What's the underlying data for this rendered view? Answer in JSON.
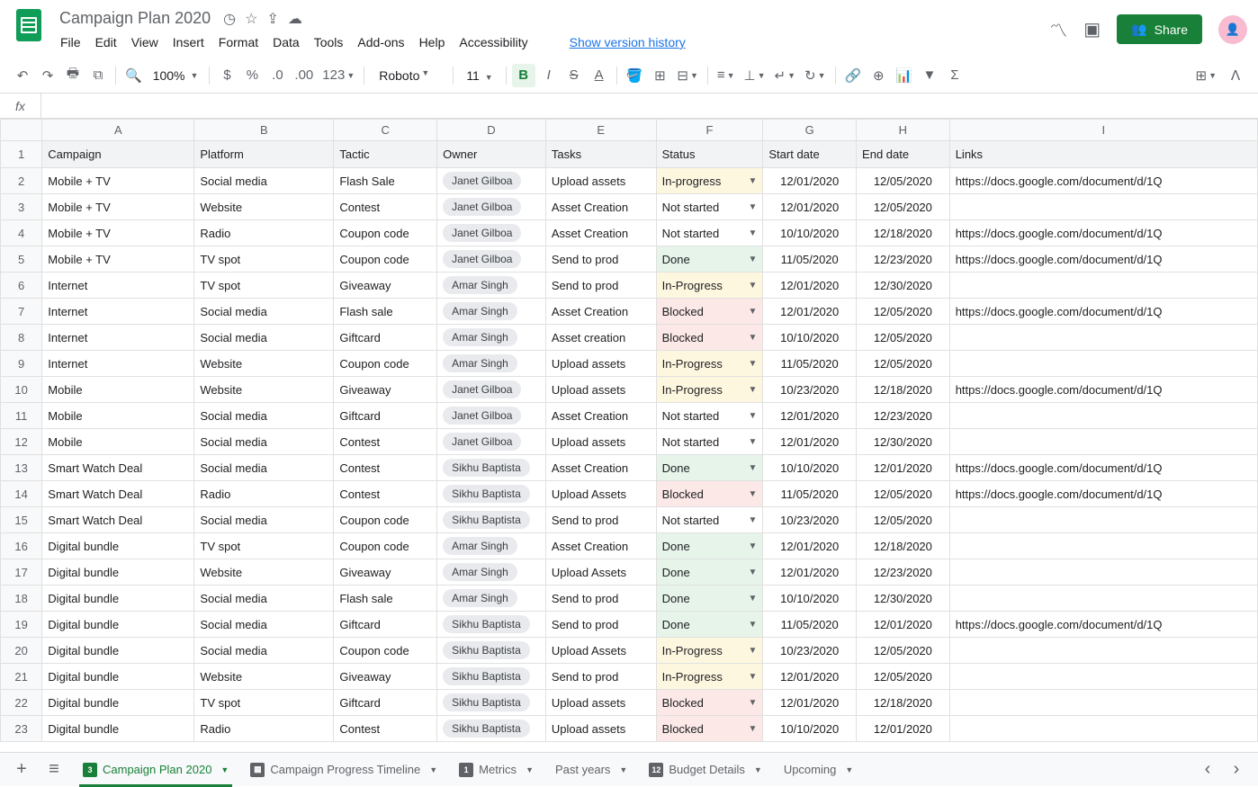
{
  "doc": {
    "title": "Campaign Plan 2020",
    "version_link": "Show version history"
  },
  "menu": [
    "File",
    "Edit",
    "View",
    "Insert",
    "Format",
    "Data",
    "Tools",
    "Add-ons",
    "Help",
    "Accessibility"
  ],
  "share_label": "Share",
  "toolbar": {
    "zoom": "100%",
    "font": "Roboto",
    "font_size": "11",
    "more_formats": "123"
  },
  "fx_label": "fx",
  "columns": [
    "A",
    "B",
    "C",
    "D",
    "E",
    "F",
    "G",
    "H",
    "I"
  ],
  "headers": {
    "A": "Campaign",
    "B": "Platform",
    "C": "Tactic",
    "D": "Owner",
    "E": "Tasks",
    "F": "Status",
    "G": "Start date",
    "H": "End date",
    "I": "Links"
  },
  "rows": [
    {
      "n": 2,
      "campaign": "Mobile + TV",
      "platform": "Social media",
      "tactic": "Flash Sale",
      "owner": "Janet Gilboa",
      "tasks": "Upload assets",
      "status": "In-progress",
      "status_cls": "st-inprogress",
      "start": "12/01/2020",
      "end": "12/05/2020",
      "links": "https://docs.google.com/document/d/1Q"
    },
    {
      "n": 3,
      "campaign": "Mobile + TV",
      "platform": "Website",
      "tactic": "Contest",
      "owner": "Janet Gilboa",
      "tasks": "Asset Creation",
      "status": "Not started",
      "status_cls": "st-notstarted",
      "start": "12/01/2020",
      "end": "12/05/2020",
      "links": ""
    },
    {
      "n": 4,
      "campaign": "Mobile + TV",
      "platform": "Radio",
      "tactic": "Coupon code",
      "owner": "Janet Gilboa",
      "tasks": "Asset Creation",
      "status": "Not started",
      "status_cls": "st-notstarted",
      "start": "10/10/2020",
      "end": "12/18/2020",
      "links": "https://docs.google.com/document/d/1Q"
    },
    {
      "n": 5,
      "campaign": "Mobile + TV",
      "platform": "TV spot",
      "tactic": "Coupon code",
      "owner": "Janet Gilboa",
      "tasks": "Send to prod",
      "status": "Done",
      "status_cls": "st-done",
      "start": "11/05/2020",
      "end": "12/23/2020",
      "links": "https://docs.google.com/document/d/1Q"
    },
    {
      "n": 6,
      "campaign": "Internet",
      "platform": "TV spot",
      "tactic": "Giveaway",
      "owner": "Amar Singh",
      "tasks": "Send to prod",
      "status": "In-Progress",
      "status_cls": "st-inprogress",
      "start": "12/01/2020",
      "end": "12/30/2020",
      "links": ""
    },
    {
      "n": 7,
      "campaign": "Internet",
      "platform": "Social media",
      "tactic": "Flash sale",
      "owner": "Amar Singh",
      "tasks": "Asset Creation",
      "status": "Blocked",
      "status_cls": "st-blocked",
      "start": "12/01/2020",
      "end": "12/05/2020",
      "links": "https://docs.google.com/document/d/1Q"
    },
    {
      "n": 8,
      "campaign": "Internet",
      "platform": "Social media",
      "tactic": "Giftcard",
      "owner": "Amar Singh",
      "tasks": "Asset creation",
      "status": "Blocked",
      "status_cls": "st-blocked",
      "start": "10/10/2020",
      "end": "12/05/2020",
      "links": ""
    },
    {
      "n": 9,
      "campaign": "Internet",
      "platform": "Website",
      "tactic": "Coupon code",
      "owner": "Amar Singh",
      "tasks": "Upload assets",
      "status": "In-Progress",
      "status_cls": "st-inprogress",
      "start": "11/05/2020",
      "end": "12/05/2020",
      "links": ""
    },
    {
      "n": 10,
      "campaign": "Mobile",
      "platform": "Website",
      "tactic": "Giveaway",
      "owner": "Janet Gilboa",
      "tasks": "Upload assets",
      "status": "In-Progress",
      "status_cls": "st-inprogress",
      "start": "10/23/2020",
      "end": "12/18/2020",
      "links": "https://docs.google.com/document/d/1Q"
    },
    {
      "n": 11,
      "campaign": "Mobile",
      "platform": "Social media",
      "tactic": "Giftcard",
      "owner": "Janet Gilboa",
      "tasks": "Asset Creation",
      "status": "Not started",
      "status_cls": "st-notstarted",
      "start": "12/01/2020",
      "end": "12/23/2020",
      "links": ""
    },
    {
      "n": 12,
      "campaign": "Mobile",
      "platform": "Social media",
      "tactic": "Contest",
      "owner": "Janet Gilboa",
      "tasks": "Upload assets",
      "status": "Not started",
      "status_cls": "st-notstarted",
      "start": "12/01/2020",
      "end": "12/30/2020",
      "links": ""
    },
    {
      "n": 13,
      "campaign": "Smart Watch Deal",
      "platform": "Social media",
      "tactic": "Contest",
      "owner": "Sikhu Baptista",
      "tasks": "Asset Creation",
      "status": "Done",
      "status_cls": "st-done",
      "start": "10/10/2020",
      "end": "12/01/2020",
      "links": "https://docs.google.com/document/d/1Q"
    },
    {
      "n": 14,
      "campaign": "Smart Watch Deal",
      "platform": "Radio",
      "tactic": "Contest",
      "owner": "Sikhu Baptista",
      "tasks": "Upload Assets",
      "status": "Blocked",
      "status_cls": "st-blocked",
      "start": "11/05/2020",
      "end": "12/05/2020",
      "links": "https://docs.google.com/document/d/1Q"
    },
    {
      "n": 15,
      "campaign": "Smart Watch Deal",
      "platform": "Social media",
      "tactic": "Coupon code",
      "owner": "Sikhu Baptista",
      "tasks": "Send to prod",
      "status": "Not started",
      "status_cls": "st-notstarted",
      "start": "10/23/2020",
      "end": "12/05/2020",
      "links": ""
    },
    {
      "n": 16,
      "campaign": "Digital bundle",
      "platform": "TV spot",
      "tactic": "Coupon code",
      "owner": "Amar Singh",
      "tasks": "Asset Creation",
      "status": "Done",
      "status_cls": "st-done",
      "start": "12/01/2020",
      "end": "12/18/2020",
      "links": ""
    },
    {
      "n": 17,
      "campaign": "Digital bundle",
      "platform": "Website",
      "tactic": "Giveaway",
      "owner": "Amar Singh",
      "tasks": "Upload Assets",
      "status": "Done",
      "status_cls": "st-done",
      "start": "12/01/2020",
      "end": "12/23/2020",
      "links": ""
    },
    {
      "n": 18,
      "campaign": "Digital bundle",
      "platform": "Social media",
      "tactic": "Flash sale",
      "owner": "Amar Singh",
      "tasks": "Send to prod",
      "status": "Done",
      "status_cls": "st-done",
      "start": "10/10/2020",
      "end": "12/30/2020",
      "links": ""
    },
    {
      "n": 19,
      "campaign": "Digital bundle",
      "platform": "Social media",
      "tactic": "Giftcard",
      "owner": "Sikhu Baptista",
      "tasks": "Send to prod",
      "status": "Done",
      "status_cls": "st-done",
      "start": "11/05/2020",
      "end": "12/01/2020",
      "links": "https://docs.google.com/document/d/1Q"
    },
    {
      "n": 20,
      "campaign": "Digital bundle",
      "platform": "Social media",
      "tactic": "Coupon code",
      "owner": "Sikhu Baptista",
      "tasks": "Upload Assets",
      "status": "In-Progress",
      "status_cls": "st-inprogress",
      "start": "10/23/2020",
      "end": "12/05/2020",
      "links": ""
    },
    {
      "n": 21,
      "campaign": "Digital bundle",
      "platform": "Website",
      "tactic": "Giveaway",
      "owner": "Sikhu Baptista",
      "tasks": "Send to prod",
      "status": "In-Progress",
      "status_cls": "st-inprogress",
      "start": "12/01/2020",
      "end": "12/05/2020",
      "links": ""
    },
    {
      "n": 22,
      "campaign": "Digital bundle",
      "platform": "TV spot",
      "tactic": "Giftcard",
      "owner": "Sikhu Baptista",
      "tasks": "Upload assets",
      "status": "Blocked",
      "status_cls": "st-blocked",
      "start": "12/01/2020",
      "end": "12/18/2020",
      "links": ""
    },
    {
      "n": 23,
      "campaign": "Digital bundle",
      "platform": "Radio",
      "tactic": "Contest",
      "owner": "Sikhu Baptista",
      "tasks": "Upload assets",
      "status": "Blocked",
      "status_cls": "st-blocked",
      "start": "10/10/2020",
      "end": "12/01/2020",
      "links": ""
    }
  ],
  "sheets": [
    {
      "label": "Campaign Plan 2020",
      "active": true,
      "icon": "3",
      "icon_cls": "green"
    },
    {
      "label": "Campaign Progress Timeline",
      "active": false,
      "icon": "▦",
      "icon_cls": ""
    },
    {
      "label": "Metrics",
      "active": false,
      "icon": "1",
      "icon_cls": ""
    },
    {
      "label": "Past years",
      "active": false,
      "icon": "",
      "icon_cls": ""
    },
    {
      "label": "Budget Details",
      "active": false,
      "icon": "12",
      "icon_cls": ""
    },
    {
      "label": "Upcoming",
      "active": false,
      "icon": "",
      "icon_cls": ""
    }
  ]
}
